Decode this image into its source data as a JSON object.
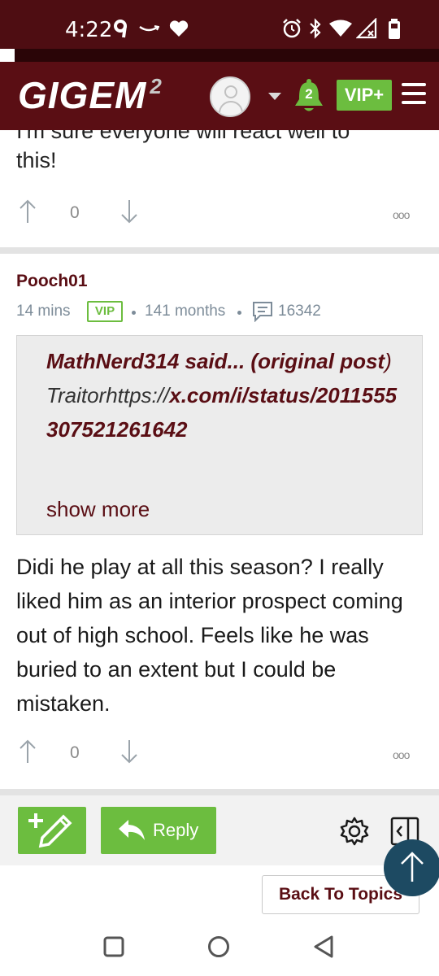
{
  "status_bar": {
    "time": "4:22"
  },
  "header": {
    "logo": "GIGEM",
    "logo_sup": "2",
    "notifications_count": "2",
    "vip_label": "VIP+"
  },
  "previous_post": {
    "cut_text": "I'm sure everyone will react well to",
    "text": "this!",
    "vote_count": "0",
    "more": "ooo"
  },
  "post": {
    "username": "Pooch01",
    "time_ago": "14 mins",
    "badge": "VIP",
    "tenure": "141 months",
    "post_count": "16342",
    "quote": {
      "author_said": "MathNerd314 said... ",
      "original_post": "(original post",
      "paren_close": ")",
      "plain_prefix": "Traitorhttps://",
      "link": "x.com/i/status/2011555307521261642",
      "show_more": "show more"
    },
    "body": "Didi he play at all this season? I really liked him as an interior prospect coming out of high school. Feels like he was buried to an extent but I could be mistaken.",
    "vote_count": "0",
    "more": "ooo"
  },
  "bottom_bar": {
    "reply_label": "Reply",
    "back_label": "Back To Topics"
  },
  "colors": {
    "maroon": "#5a0e14",
    "green": "#6cbd3f",
    "scroll_button": "#1d4a62"
  }
}
